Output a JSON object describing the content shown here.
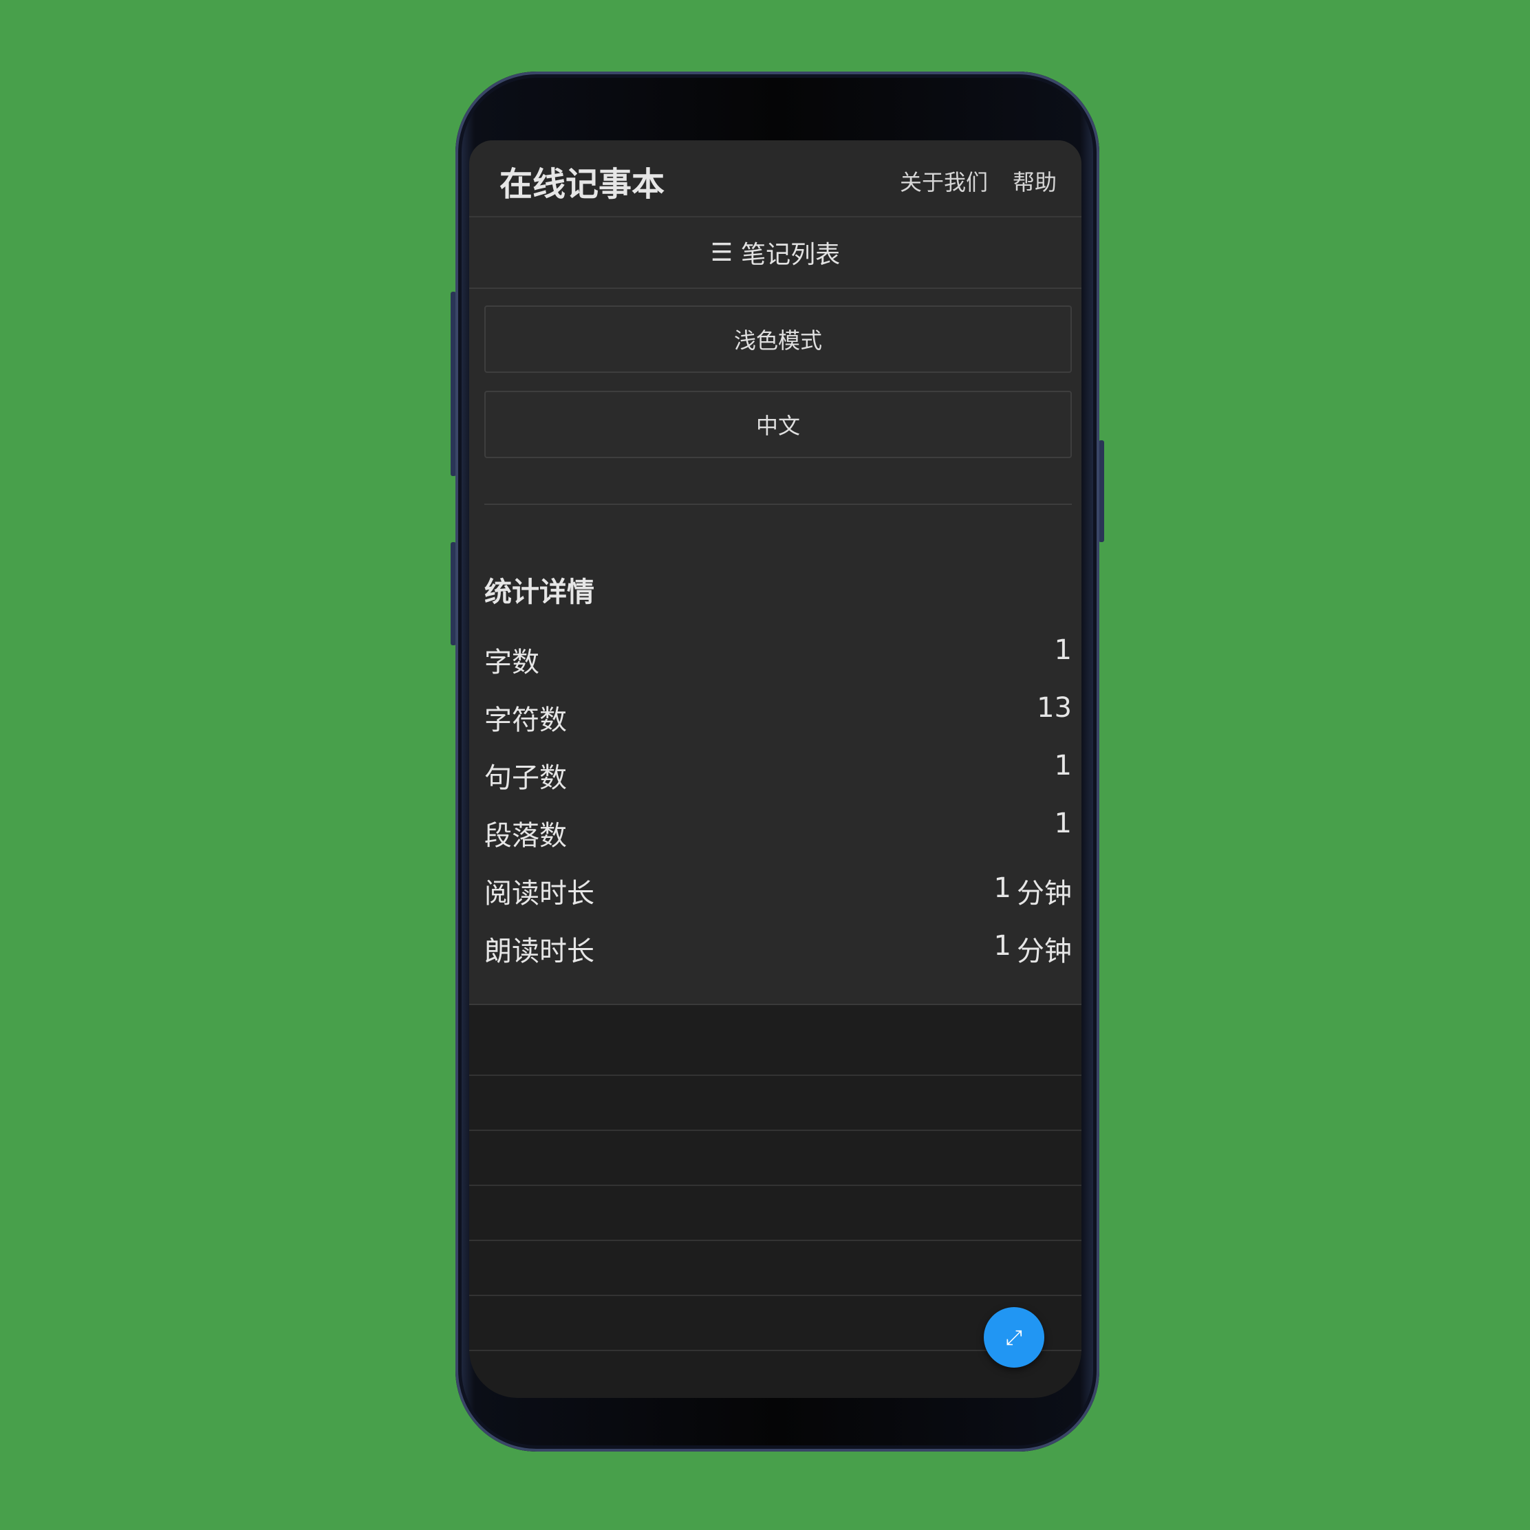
{
  "app": {
    "title": "在线记事本",
    "nav": {
      "about": "关于我们",
      "help": "帮助"
    }
  },
  "sidebar": {
    "notes_list_icon": "menu-icon",
    "notes_list_glyph": "☰",
    "notes_list_label": "笔记列表",
    "theme_button": "浅色模式",
    "language_button": "中文"
  },
  "stats": {
    "title": "统计详情",
    "rows": [
      {
        "label": "字数",
        "value": "1",
        "unit": ""
      },
      {
        "label": "字符数",
        "value": "13",
        "unit": ""
      },
      {
        "label": "句子数",
        "value": "1",
        "unit": ""
      },
      {
        "label": "段落数",
        "value": "1",
        "unit": ""
      },
      {
        "label": "阅读时长",
        "value": "1",
        "unit": "分钟"
      },
      {
        "label": "朗读时长",
        "value": "1",
        "unit": "分钟"
      }
    ]
  },
  "fab": {
    "icon": "expand-arrows-icon",
    "glyph": "⤢"
  },
  "colors": {
    "background": "#48a04b",
    "panel": "#2a2a2a",
    "editor": "#1d1d1d",
    "accent": "#2196f3"
  }
}
